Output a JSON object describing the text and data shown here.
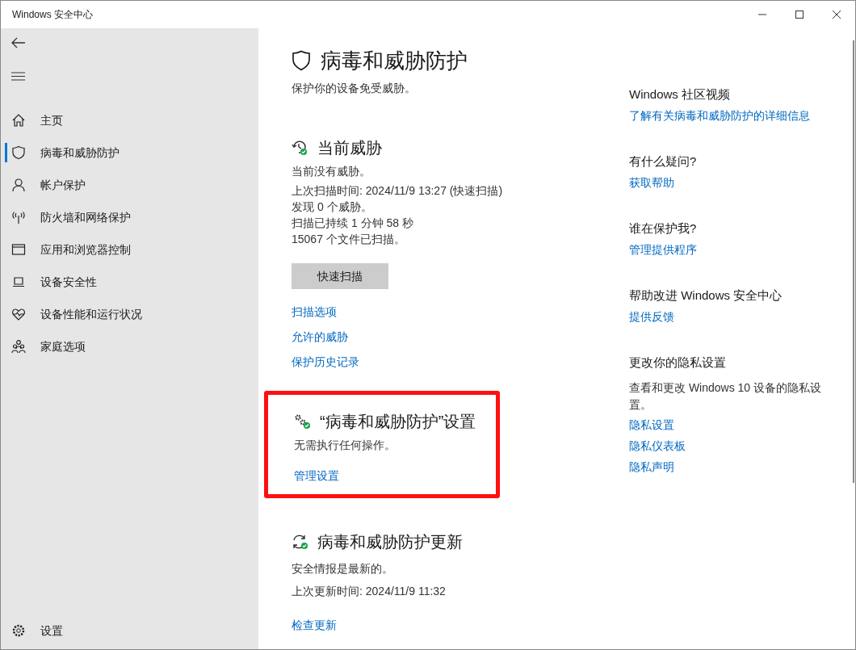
{
  "window": {
    "title": "Windows 安全中心"
  },
  "sidebar": {
    "items": [
      {
        "label": "主页",
        "kind": "home",
        "selected": false
      },
      {
        "label": "病毒和威胁防护",
        "kind": "shield",
        "selected": true
      },
      {
        "label": "帐户保护",
        "kind": "person",
        "selected": false
      },
      {
        "label": "防火墙和网络保护",
        "kind": "antenna",
        "selected": false
      },
      {
        "label": "应用和浏览器控制",
        "kind": "window",
        "selected": false
      },
      {
        "label": "设备安全性",
        "kind": "laptop",
        "selected": false
      },
      {
        "label": "设备性能和运行状况",
        "kind": "heart",
        "selected": false
      },
      {
        "label": "家庭选项",
        "kind": "family",
        "selected": false
      }
    ],
    "footer": {
      "label": "设置"
    }
  },
  "page": {
    "title": "病毒和威胁防护",
    "subtitle": "保护你的设备免受威胁。"
  },
  "sections": [
    {
      "kind": "clock",
      "title": "当前威胁",
      "highlighted": false,
      "lines": [
        "当前没有威胁。",
        "上次扫描时间: 2024/11/9 13:27 (快速扫描)",
        "发现 0 个威胁。",
        "扫描已持续 1 分钟 58 秒",
        "15067 个文件已扫描。"
      ],
      "button": "快速扫描",
      "links": [
        "扫描选项",
        "允许的威胁",
        "保护历史记录"
      ]
    },
    {
      "kind": "gears",
      "title": "“病毒和威胁防护”设置",
      "highlighted": true,
      "lines": [
        "无需执行任何操作。"
      ],
      "links": [
        "管理设置"
      ]
    },
    {
      "kind": "sync",
      "title": "病毒和威胁防护更新",
      "highlighted": false,
      "lines": [
        "安全情报是最新的。",
        "上次更新时间: 2024/11/9 11:32"
      ],
      "links": [
        "检查更新"
      ]
    }
  ],
  "aside": [
    {
      "heading": "Windows 社区视频",
      "links": [
        "了解有关病毒和威胁防护的详细信息"
      ]
    },
    {
      "heading": "有什么疑问?",
      "links": [
        "获取帮助"
      ]
    },
    {
      "heading": "谁在保护我?",
      "links": [
        "管理提供程序"
      ]
    },
    {
      "heading": "帮助改进 Windows 安全中心",
      "links": [
        "提供反馈"
      ]
    },
    {
      "heading": "更改你的隐私设置",
      "text": "查看和更改 Windows 10 设备的隐私设置。",
      "links": [
        "隐私设置",
        "隐私仪表板",
        "隐私声明"
      ]
    }
  ]
}
